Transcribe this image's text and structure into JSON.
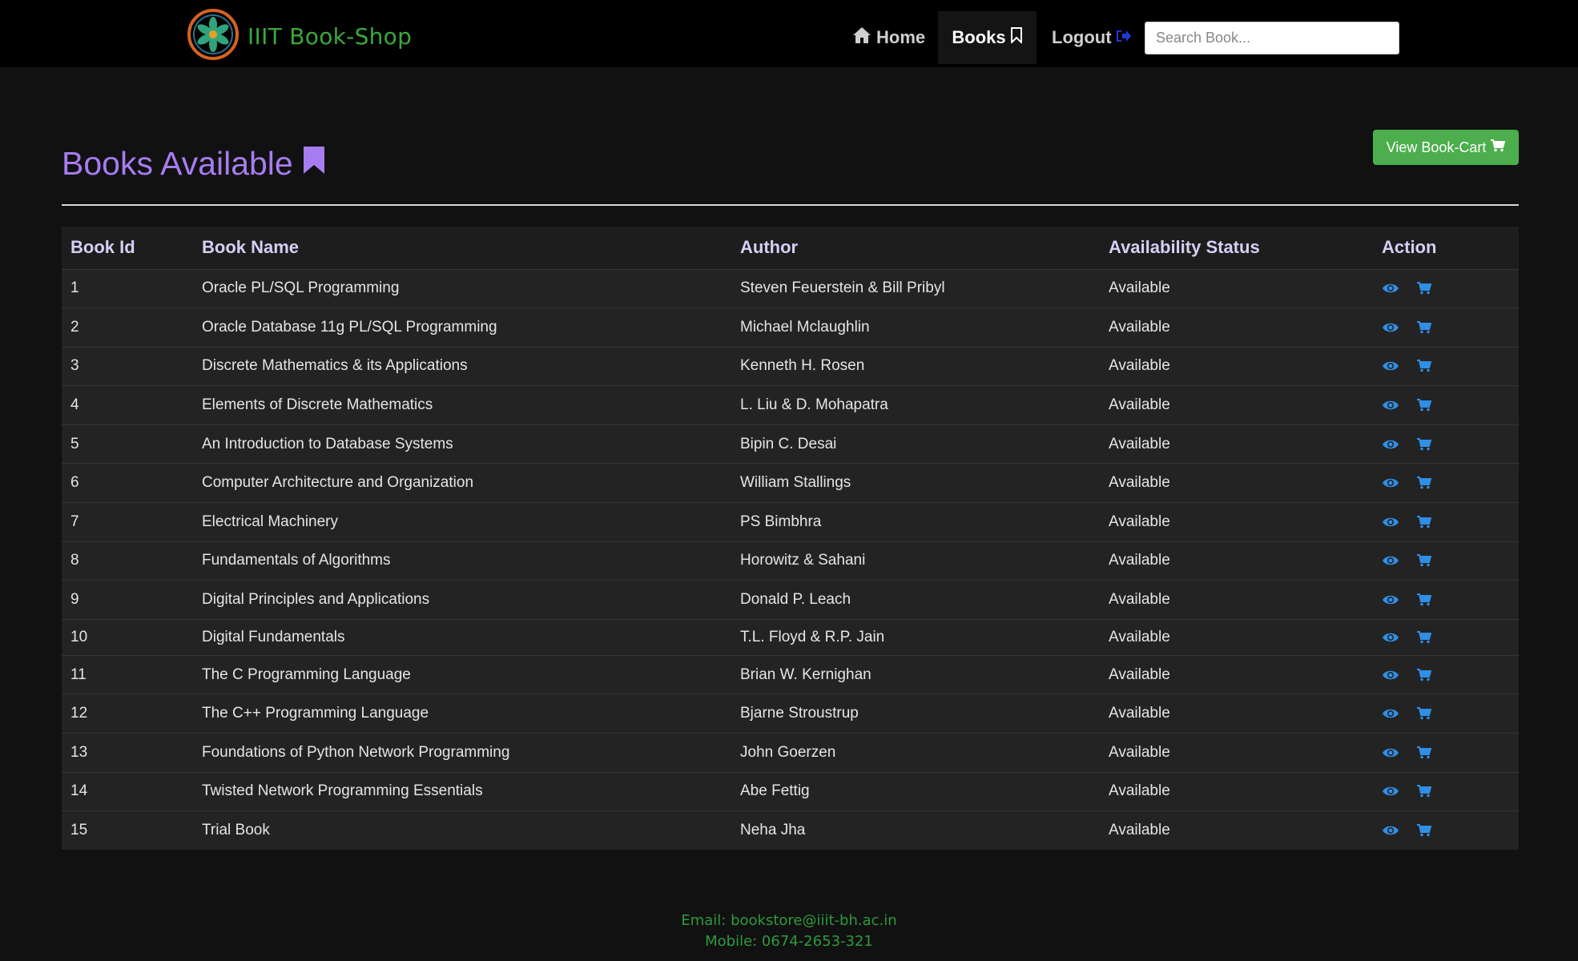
{
  "brand": {
    "name": "IIIT Book-Shop"
  },
  "nav": {
    "home": "Home",
    "books": "Books",
    "logout": "Logout",
    "search_placeholder": "Search Book..."
  },
  "cart_button": "View Book-Cart",
  "page_title": "Books Available",
  "table": {
    "headers": [
      "Book Id",
      "Book Name",
      "Author",
      "Availability Status",
      "Action"
    ],
    "rows": [
      {
        "id": "1",
        "name": "Oracle PL/SQL Programming",
        "author": "Steven Feuerstein & Bill Pribyl",
        "status": "Available"
      },
      {
        "id": "2",
        "name": "Oracle Database 11g PL/SQL Programming",
        "author": "Michael Mclaughlin",
        "status": "Available"
      },
      {
        "id": "3",
        "name": "Discrete Mathematics & its Applications",
        "author": "Kenneth H. Rosen",
        "status": "Available"
      },
      {
        "id": "4",
        "name": "Elements of Discrete Mathematics",
        "author": "L. Liu & D. Mohapatra",
        "status": "Available"
      },
      {
        "id": "5",
        "name": "An Introduction to Database Systems",
        "author": "Bipin C. Desai",
        "status": "Available"
      },
      {
        "id": "6",
        "name": "Computer Architecture and Organization",
        "author": "William Stallings",
        "status": "Available"
      },
      {
        "id": "7",
        "name": "Electrical Machinery",
        "author": "PS Bimbhra",
        "status": "Available"
      },
      {
        "id": "8",
        "name": "Fundamentals of Algorithms",
        "author": "Horowitz & Sahani",
        "status": "Available"
      },
      {
        "id": "9",
        "name": "Digital Principles and Applications",
        "author": "Donald P. Leach",
        "status": "Available"
      },
      {
        "id": "10",
        "name": "Digital Fundamentals",
        "author": "T.L. Floyd & R.P. Jain",
        "status": "Available"
      },
      {
        "id": "11",
        "name": "The C Programming Language",
        "author": "Brian W. Kernighan",
        "status": "Available"
      },
      {
        "id": "12",
        "name": "The C++ Programming Language",
        "author": "Bjarne Stroustrup",
        "status": "Available"
      },
      {
        "id": "13",
        "name": "Foundations of Python Network Programming",
        "author": "John Goerzen",
        "status": "Available"
      },
      {
        "id": "14",
        "name": "Twisted Network Programming Essentials",
        "author": "Abe Fettig",
        "status": "Available"
      },
      {
        "id": "15",
        "name": "Trial Book",
        "author": "Neha Jha",
        "status": "Available"
      }
    ]
  },
  "footer": {
    "email": "Email: bookstore@iiit-bh.ac.in",
    "mobile": "Mobile: 0674-2653-321"
  },
  "colors": {
    "accent": "#a77cf0",
    "brand": "#3aa83a",
    "cart_button": "#4cae4c",
    "action_icon": "#2f8fe6"
  },
  "icons": {
    "logo": "iiit-logo",
    "home": "home-icon",
    "books": "bookmark-icon",
    "logout": "sign-out-icon",
    "cart": "shopping-cart-icon",
    "title": "bookmark-icon",
    "row_view": "eye-icon",
    "row_cart": "shopping-cart-icon"
  }
}
